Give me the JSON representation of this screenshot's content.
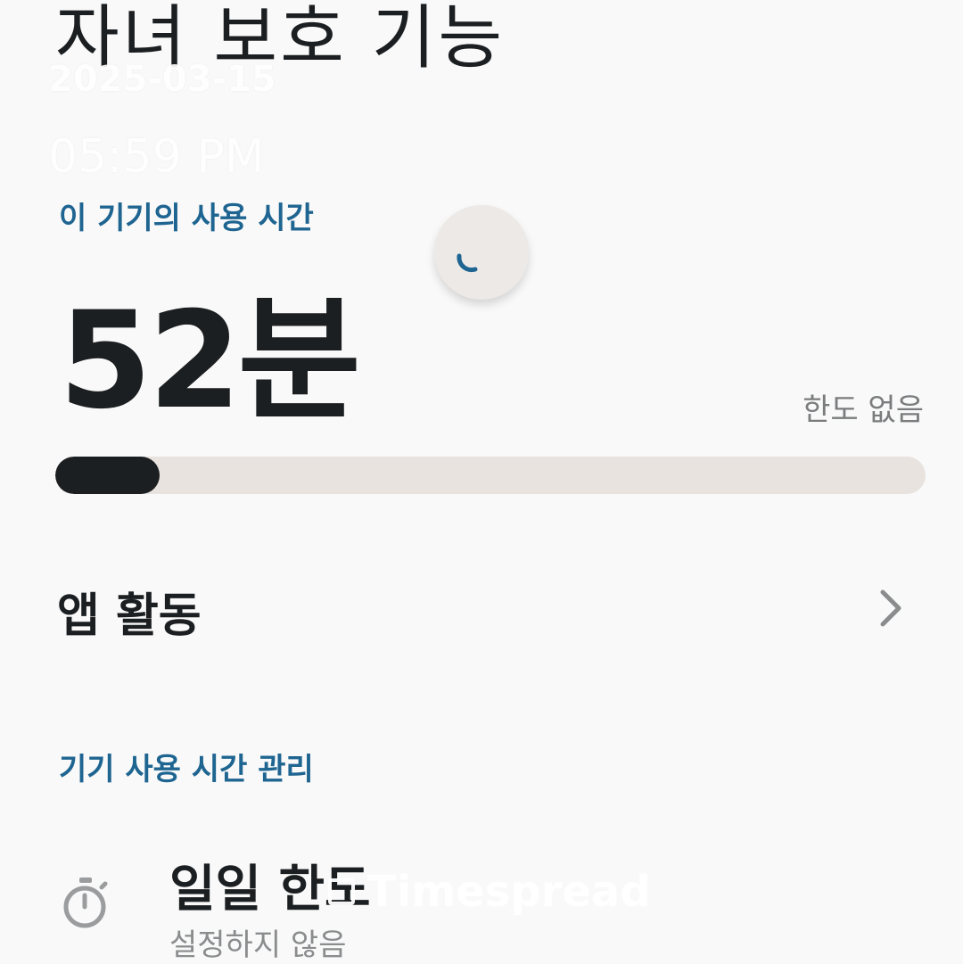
{
  "header": {
    "title": "자녀 보호 기능"
  },
  "timestamp": {
    "date": "2025-03-15",
    "time": "05:59 PM"
  },
  "usage": {
    "section_title": "이 기기의 사용 시간",
    "value": "52분",
    "limit_label": "한도 없음",
    "progress_fraction": 0.12
  },
  "app_activity": {
    "label": "앱 활동",
    "icon": "chevron-right-icon"
  },
  "management": {
    "section_title": "기기 사용 시간 관리",
    "daily_limit": {
      "title": "일일 한도",
      "subtitle": "설정하지 않음",
      "icon": "timer-icon"
    }
  },
  "watermark": {
    "text": "Timespread"
  },
  "colors": {
    "accent": "#1f6591",
    "progress_fill": "#1c1f21",
    "progress_track": "#e8e3df"
  }
}
